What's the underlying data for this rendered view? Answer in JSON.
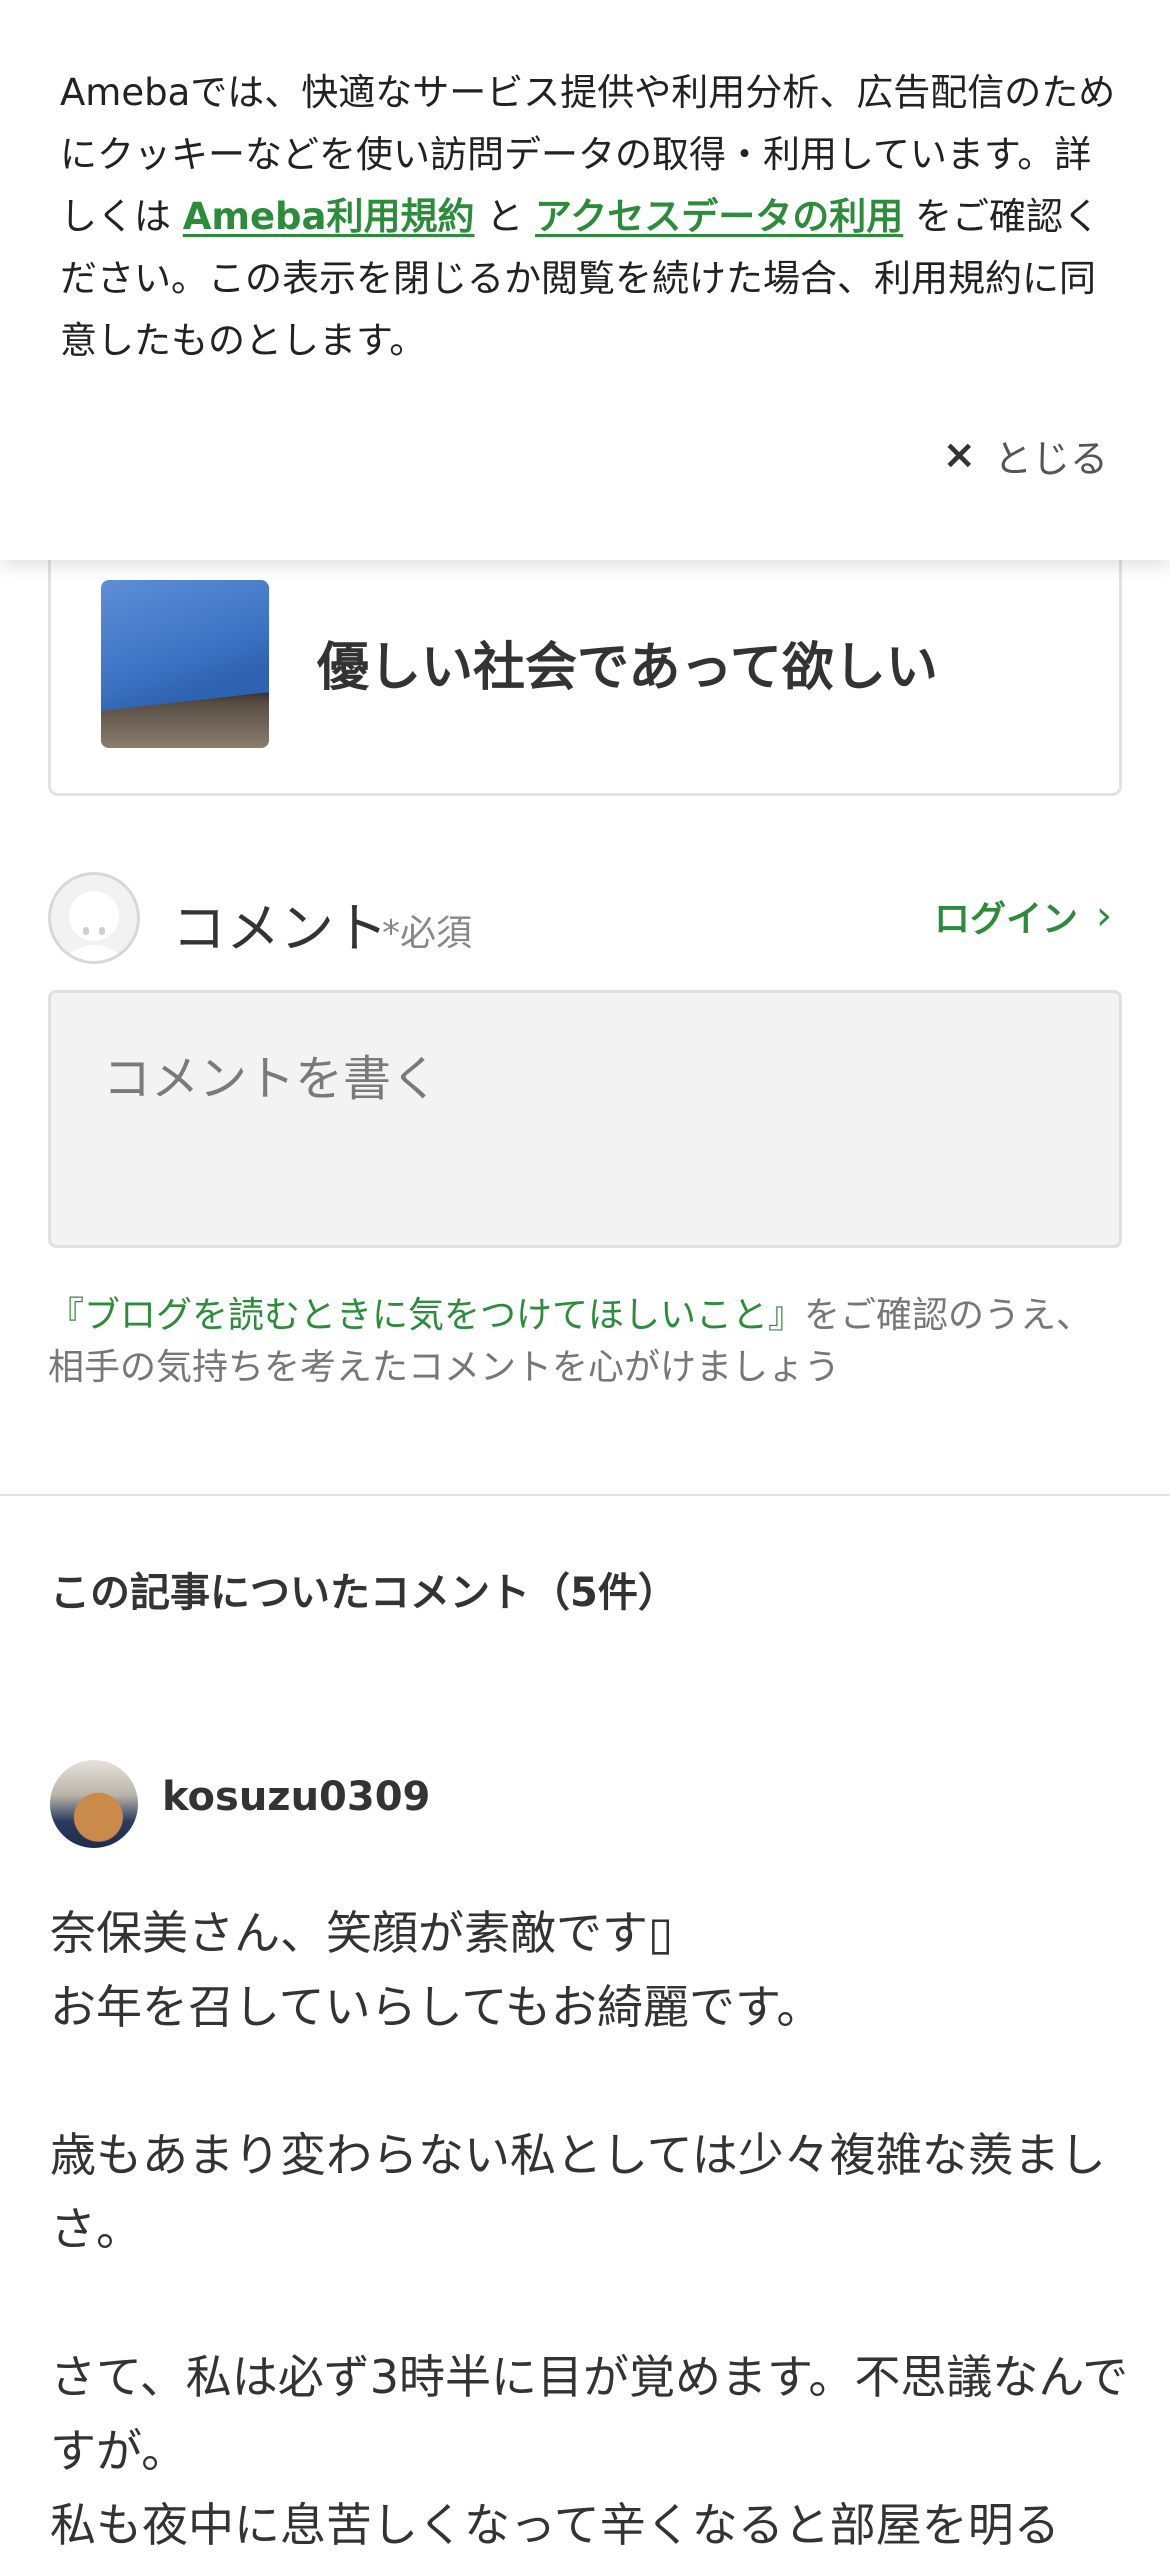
{
  "cookie_banner": {
    "text_1": "Amebaでは、快適なサービス提供や利用分析、広告配信のためにクッキーなどを使い訪問データの取得・利用しています。詳しくは ",
    "link_terms": "Ameba利用規約",
    "text_2": " と ",
    "link_access": "アクセスデータの利用",
    "text_3": " をご確認ください。この表示を閉じるか閲覧を続けた場合、利用規約に同意したものとします。",
    "close_label": "とじる",
    "close_icon": "×"
  },
  "article": {
    "title": "優しい社会であって欲しい"
  },
  "comment_form": {
    "label": "コメント",
    "required": "*必須",
    "login_label": "ログイン",
    "login_chevron": "›",
    "placeholder": "コメントを書く",
    "guideline_link": "『ブログを読むときに気をつけてほしいこと』",
    "guideline_text": "をご確認のうえ、相手の気持ちを考えたコメントを心がけましょう"
  },
  "comments": {
    "heading": "この記事についたコメント（5件）",
    "items": [
      {
        "user": "kosuzu0309",
        "body": "奈保美さん、笑顔が素敵です▯\nお年を召していらしてもお綺麗です。\n\n歳もあまり変わらない私としては少々複雑な羨ましさ。\n\nさて、私は必ず3時半に目が覚めます。不思議なんですが。\n私も夜中に息苦しくなって辛くなると部屋を明る"
      }
    ]
  },
  "colors": {
    "accent_green": "#2d8c3c",
    "text": "#333333",
    "muted": "#777777",
    "textarea_bg": "#f3f3f3"
  }
}
